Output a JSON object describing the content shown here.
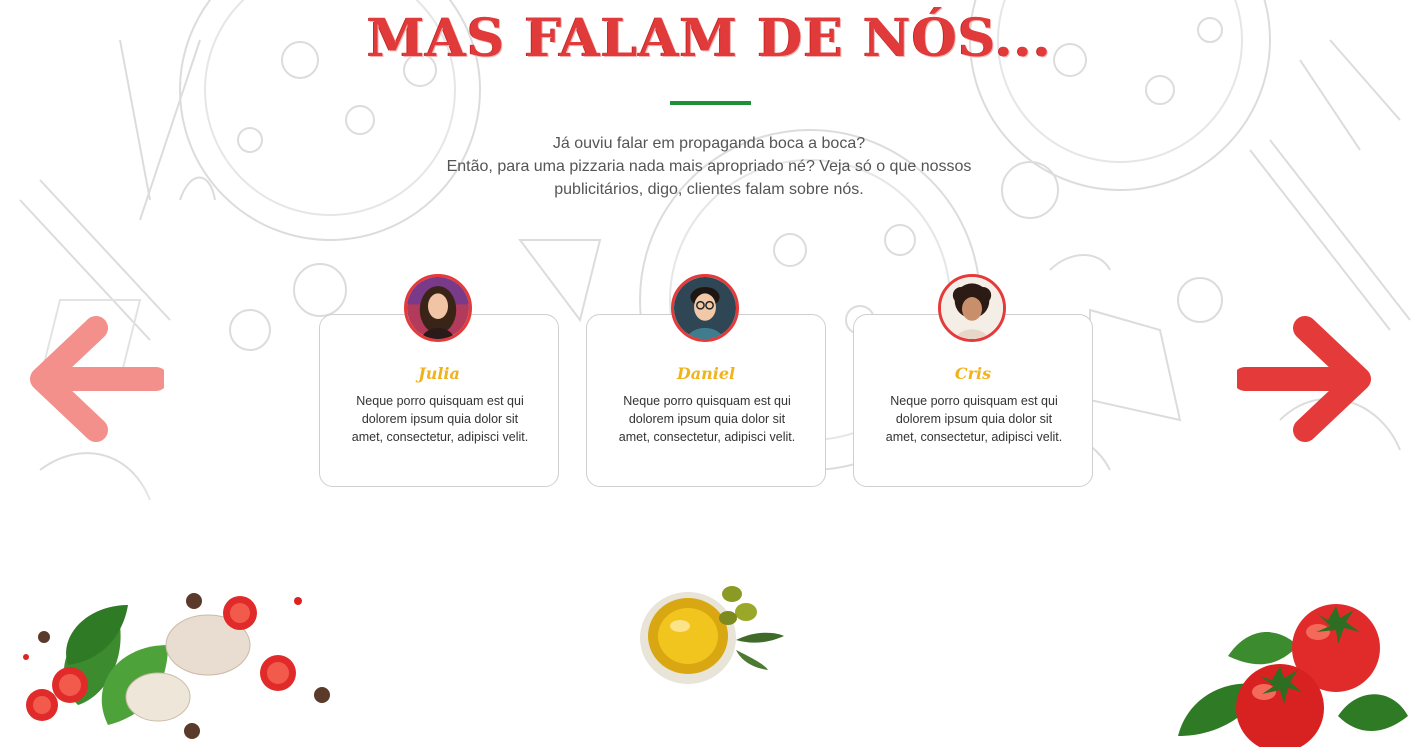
{
  "section": {
    "title": "MAS FALAM DE NÓS...",
    "intro_line1": "Já ouviu falar em propaganda boca a boca?",
    "intro_line2": "Então, para uma pizzaria nada mais apropriado né? Veja só o que nossos",
    "intro_line3": "publicitários, digo, clientes falam sobre nós."
  },
  "testimonials": [
    {
      "name": "Julia",
      "text": "Neque porro quisquam est qui dolorem ipsum quia dolor sit amet, consectetur, adipisci velit."
    },
    {
      "name": "Daniel",
      "text": "Neque porro quisquam est qui dolorem ipsum quia dolor sit amet, consectetur, adipisci velit."
    },
    {
      "name": "Cris",
      "text": "Neque porro quisquam est qui dolorem ipsum quia dolor sit amet, consectetur, adipisci velit."
    }
  ],
  "nav": {
    "prev_icon": "arrow-left-icon",
    "next_icon": "arrow-right-icon"
  },
  "colors": {
    "title_red": "#e03a3a",
    "accent_green": "#1f8f3a",
    "name_yellow": "#f2b21c",
    "arrow_red": "#e53a3a",
    "arrow_red_faded": "#f3908c"
  }
}
